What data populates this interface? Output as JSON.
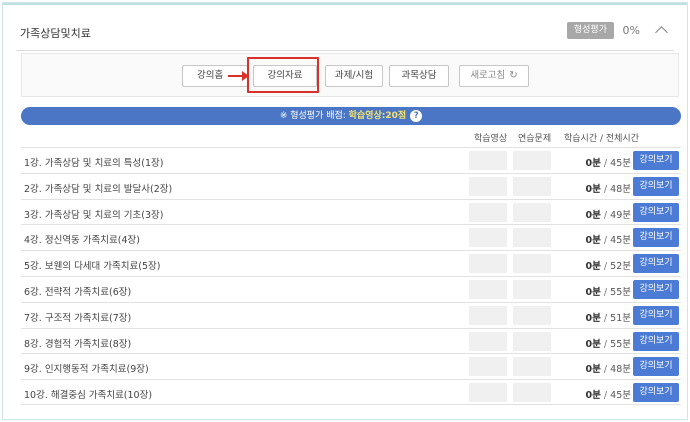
{
  "header": {
    "title": "가족상담및치료",
    "badge": "형성평가",
    "percent": "0%"
  },
  "tabs": {
    "home": "강의홈",
    "material": "강의자료",
    "task": "과제/시험",
    "subject": "과목상담",
    "refresh": "새로고침"
  },
  "info": {
    "label": "※ 형성평가 배점: ",
    "value": "학습영상:20점",
    "help": "?"
  },
  "columns": {
    "video": "학습영상",
    "quiz": "연습문제",
    "time": "학습시간 / 전체시간"
  },
  "view_button_label": "강의보기",
  "lectures": [
    {
      "title": "1강. 가족상담 및 치료의 특성(1장)",
      "study": "0분",
      "total": "45분"
    },
    {
      "title": "2강. 가족상담 및 치료의 발달사(2장)",
      "study": "0분",
      "total": "48분"
    },
    {
      "title": "3강. 가족상담 및 치료의 기초(3장)",
      "study": "0분",
      "total": "49분"
    },
    {
      "title": "4강. 정신역동 가족치료(4장)",
      "study": "0분",
      "total": "45분"
    },
    {
      "title": "5강. 보웬의 다세대 가족치료(5장)",
      "study": "0분",
      "total": "52분"
    },
    {
      "title": "6강. 전략적 가족치료(6장)",
      "study": "0분",
      "total": "55분"
    },
    {
      "title": "7강. 구조적 가족치료(7장)",
      "study": "0분",
      "total": "51분"
    },
    {
      "title": "8강. 경험적 가족치료(8장)",
      "study": "0분",
      "total": "55분"
    },
    {
      "title": "9강. 인지행동적 가족치료(9장)",
      "study": "0분",
      "total": "48분"
    },
    {
      "title": "10강. 해결중심 가족치료(10장)",
      "study": "0분",
      "total": "45분"
    }
  ],
  "colors": {
    "accent_blue": "#4c7bd6",
    "info_bar": "#4a76c5",
    "highlight_red": "#d9302a",
    "info_value": "#f7e36c"
  }
}
